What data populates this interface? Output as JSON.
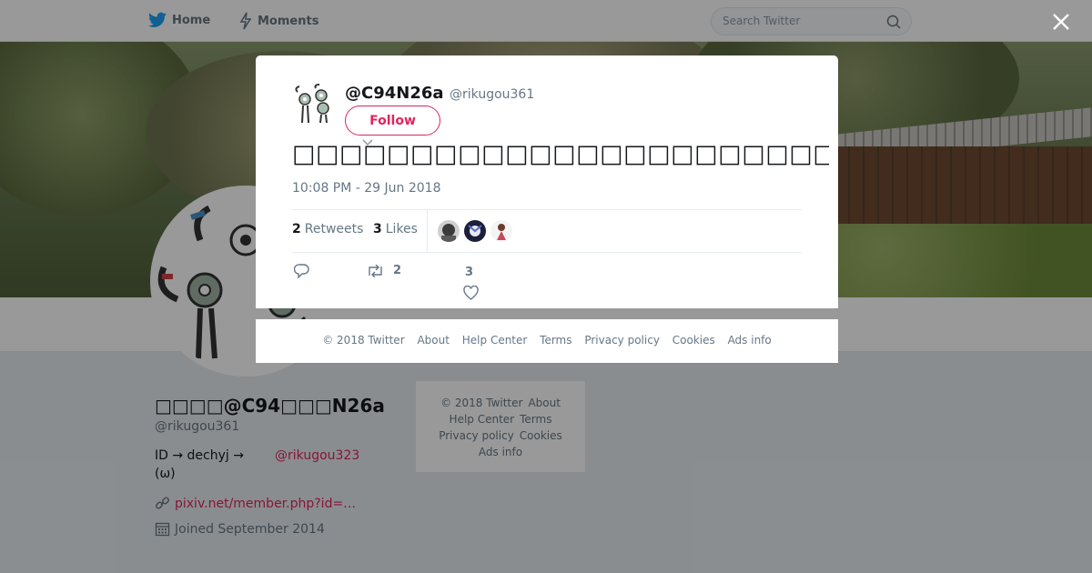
{
  "nav": {
    "home_label": "Home",
    "moments_label": "Moments",
    "search_placeholder": "Search Twitter"
  },
  "profile": {
    "display_name": "□□□□@C94□□□N26a",
    "handle": "@rikugou361",
    "bio_line1": "ID → dechyj  →",
    "bio_link": "@rikugou323",
    "bio_line2": "(ω)",
    "url": "pixiv.net/member.php?id=…",
    "joined": "Joined September 2014"
  },
  "side_footer": {
    "copyright": "© 2018 Twitter",
    "about": "About",
    "help": "Help Center",
    "terms": "Terms",
    "privacy": "Privacy policy",
    "cookies": "Cookies",
    "ads": "Ads info"
  },
  "tweet": {
    "name": "@C94N26a",
    "handle": "@rikugou361",
    "follow_label": "Follow",
    "text": "□□□□□□□□□□□□□□□□□□□□□□□□□□□□□□□□□□□□□□□□□□□□□□□□□□",
    "time": "10:08 PM - 29 Jun 2018",
    "retweets_count": "2",
    "retweets_label": "Retweets",
    "likes_count": "3",
    "likes_label": "Likes",
    "action_retweet_count": "2",
    "action_like_count": "3"
  },
  "modal_footer": {
    "copyright": "© 2018 Twitter",
    "about": "About",
    "help": "Help Center",
    "terms": "Terms",
    "privacy": "Privacy policy",
    "cookies": "Cookies",
    "ads": "Ads info"
  },
  "colors": {
    "accent": "#e0245e",
    "twitter_blue": "#1da1f2",
    "text_secondary": "#657786"
  },
  "icons": [
    "twitter-bird-icon",
    "lightning-icon",
    "search-icon",
    "close-icon",
    "caret-down-icon",
    "reply-icon",
    "retweet-icon",
    "heart-icon",
    "link-icon",
    "calendar-icon"
  ]
}
